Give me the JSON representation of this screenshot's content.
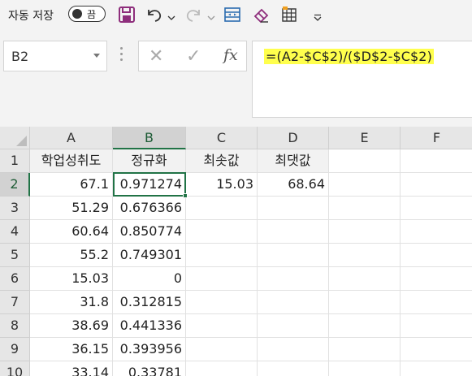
{
  "quick_access": {
    "autosave_label": "자동 저장",
    "autosave_state": "끔",
    "icons": [
      "save-icon",
      "undo-icon",
      "undo-dropdown-icon",
      "redo-icon",
      "redo-dropdown-icon",
      "fit-width-icon",
      "eraser-icon",
      "table-icon",
      "customize-dropdown-icon"
    ]
  },
  "name_box": {
    "value": "B2"
  },
  "formula_bar": {
    "cancel_glyph": "✕",
    "enter_glyph": "✓",
    "fx_label": "fx",
    "formula": "=(A2-$C$2)/($D$2-$C$2)",
    "highlight_color": "#ffff4d"
  },
  "columns": [
    "A",
    "B",
    "C",
    "D",
    "E",
    "F"
  ],
  "rows": [
    "1",
    "2",
    "3",
    "4",
    "5",
    "6",
    "7",
    "8",
    "9",
    "10"
  ],
  "selected_cell": {
    "column": "B",
    "row": "2"
  },
  "cells": {
    "A1": "학업성취도",
    "B1": "정규화",
    "C1": "최솟값",
    "D1": "최댓값",
    "A2": "67.1",
    "B2": "0.971274",
    "C2": "15.03",
    "D2": "68.64",
    "A3": "51.29",
    "B3": "0.676366",
    "A4": "60.64",
    "B4": "0.850774",
    "A5": "55.2",
    "B5": "0.749301",
    "A6": "15.03",
    "B6": "0",
    "A7": "31.8",
    "B7": "0.312815",
    "A8": "38.69",
    "B8": "0.441336",
    "A9": "36.15",
    "B9": "0.393956",
    "A10": "33.14",
    "B10": "0.33781"
  },
  "colors": {
    "accent": "#217346",
    "save_icon": "#8e2e7c"
  }
}
